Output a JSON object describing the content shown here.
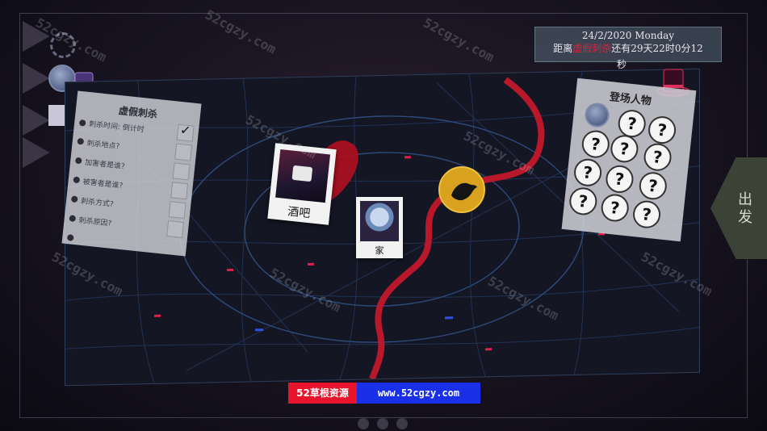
{
  "date_panel": {
    "date_line": "24/2/2020  Monday",
    "countdown_prefix": "距离",
    "case_name": "虚假刺杀",
    "countdown_mid": "还有29天22时0分12",
    "countdown_end": "秒"
  },
  "checklist": {
    "title": "虚假刺杀",
    "items": [
      {
        "label": "刺杀时间: 倒计时",
        "checked": true
      },
      {
        "label": "刺杀地点?",
        "checked": false
      },
      {
        "label": "加害者是谁?",
        "checked": false
      },
      {
        "label": "被害者是谁?",
        "checked": false
      },
      {
        "label": "刺杀方式?",
        "checked": false
      },
      {
        "label": "刺杀原因?",
        "checked": false
      }
    ]
  },
  "locations": {
    "bar_label": "酒吧",
    "home_label": "家"
  },
  "characters": {
    "title": "登场人物",
    "unknown_mark": "?"
  },
  "depart_button": "出发",
  "banner": {
    "left": "52草根资源",
    "right": "www.52cgzy.com"
  },
  "watermark": "52cgzy.com",
  "colors": {
    "accent_red": "#e0203a",
    "river_red": "#c2182c",
    "banner_red": "#e8142c",
    "banner_blue": "#1a30e8"
  }
}
